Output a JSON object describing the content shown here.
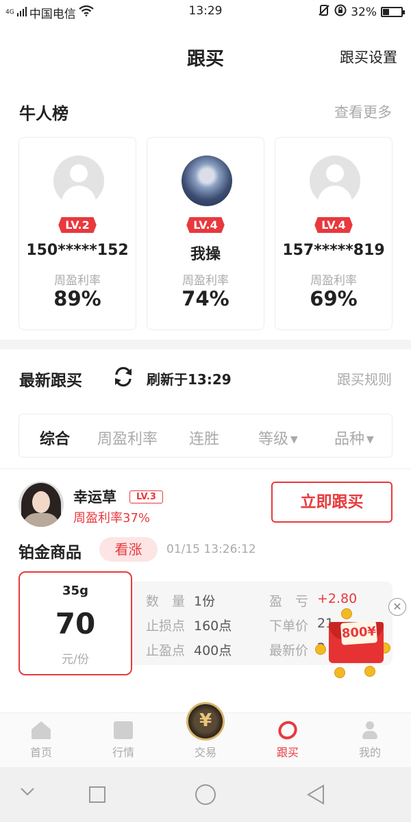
{
  "status": {
    "network": "4G",
    "carrier": "中国电信",
    "time": "13:29",
    "battery": "32%"
  },
  "header": {
    "title": "跟买",
    "settings": "跟买设置"
  },
  "ranking": {
    "title": "牛人榜",
    "more": "查看更多",
    "cards": [
      {
        "level": "LV.2",
        "name": "150*****152",
        "label": "周盈利率",
        "value": "89%",
        "avatar": "default-avatar-icon"
      },
      {
        "level": "LV.4",
        "name": "我操",
        "label": "周盈利率",
        "value": "74%",
        "avatar": "game-avatar"
      },
      {
        "level": "LV.4",
        "name": "157*****819",
        "label": "周盈利率",
        "value": "69%",
        "avatar": "default-avatar-icon"
      }
    ]
  },
  "latest": {
    "title": "最新跟买",
    "refresh_text": "刷新于13:29",
    "rules": "跟买规则"
  },
  "filters": {
    "items": [
      "综合",
      "周盈利率",
      "连胜",
      "等级",
      "品种"
    ],
    "active": "综合"
  },
  "feed": {
    "user": {
      "name": "幸运草",
      "level": "LV.3",
      "rate": "周盈利率37%"
    },
    "follow_button": "立即跟买",
    "product": "铂金商品",
    "direction": "看涨",
    "datetime": "01/15 13:26:12",
    "spec": {
      "weight": "35g",
      "price": "70",
      "unit": "元/份"
    },
    "details": {
      "qty_label": "数　量",
      "qty_value": "1份",
      "pl_label": "盈　亏",
      "pl_value": "+2.80",
      "stop_loss_label": "止损点",
      "stop_loss_value": "160点",
      "order_price_label": "下单价",
      "order_price_value": "21",
      "take_profit_label": "止盈点",
      "take_profit_value": "400点",
      "latest_price_label": "最新价",
      "latest_price_value": "2"
    }
  },
  "ad": {
    "amount": "800¥"
  },
  "tabbar": {
    "items": [
      {
        "label": "首页",
        "icon": "home-icon"
      },
      {
        "label": "行情",
        "icon": "market-icon"
      },
      {
        "label": "交易",
        "icon": "yuan-icon"
      },
      {
        "label": "跟买",
        "icon": "link-icon"
      },
      {
        "label": "我的",
        "icon": "profile-icon"
      }
    ],
    "trade_glyph": "¥",
    "active": "跟买"
  },
  "colors": {
    "accent": "#e8393d",
    "muted": "#aaaaaa",
    "separator": "#f4f4f4"
  }
}
